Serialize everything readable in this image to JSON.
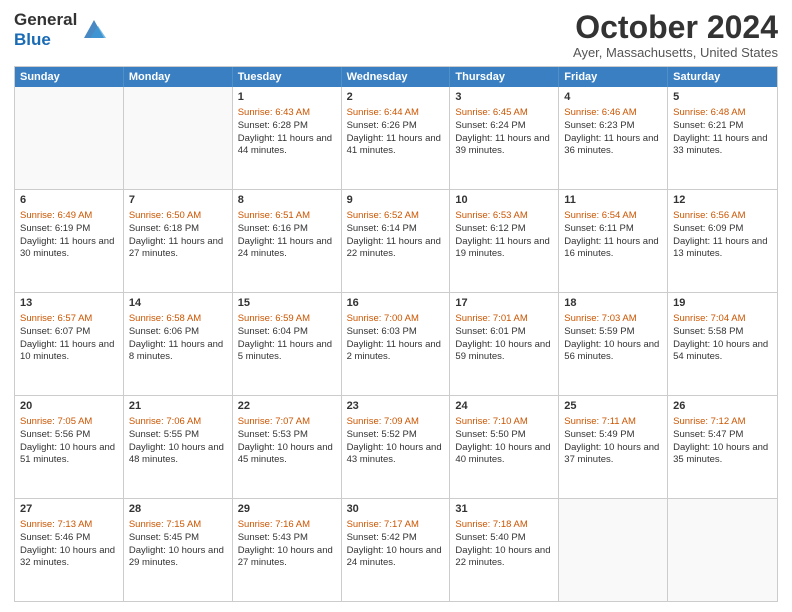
{
  "header": {
    "logo_line1": "General",
    "logo_line2": "Blue",
    "month": "October 2024",
    "location": "Ayer, Massachusetts, United States"
  },
  "weekdays": [
    "Sunday",
    "Monday",
    "Tuesday",
    "Wednesday",
    "Thursday",
    "Friday",
    "Saturday"
  ],
  "weeks": [
    [
      {
        "day": "",
        "sunrise": "",
        "sunset": "",
        "daylight": ""
      },
      {
        "day": "",
        "sunrise": "",
        "sunset": "",
        "daylight": ""
      },
      {
        "day": "1",
        "sunrise": "Sunrise: 6:43 AM",
        "sunset": "Sunset: 6:28 PM",
        "daylight": "Daylight: 11 hours and 44 minutes."
      },
      {
        "day": "2",
        "sunrise": "Sunrise: 6:44 AM",
        "sunset": "Sunset: 6:26 PM",
        "daylight": "Daylight: 11 hours and 41 minutes."
      },
      {
        "day": "3",
        "sunrise": "Sunrise: 6:45 AM",
        "sunset": "Sunset: 6:24 PM",
        "daylight": "Daylight: 11 hours and 39 minutes."
      },
      {
        "day": "4",
        "sunrise": "Sunrise: 6:46 AM",
        "sunset": "Sunset: 6:23 PM",
        "daylight": "Daylight: 11 hours and 36 minutes."
      },
      {
        "day": "5",
        "sunrise": "Sunrise: 6:48 AM",
        "sunset": "Sunset: 6:21 PM",
        "daylight": "Daylight: 11 hours and 33 minutes."
      }
    ],
    [
      {
        "day": "6",
        "sunrise": "Sunrise: 6:49 AM",
        "sunset": "Sunset: 6:19 PM",
        "daylight": "Daylight: 11 hours and 30 minutes."
      },
      {
        "day": "7",
        "sunrise": "Sunrise: 6:50 AM",
        "sunset": "Sunset: 6:18 PM",
        "daylight": "Daylight: 11 hours and 27 minutes."
      },
      {
        "day": "8",
        "sunrise": "Sunrise: 6:51 AM",
        "sunset": "Sunset: 6:16 PM",
        "daylight": "Daylight: 11 hours and 24 minutes."
      },
      {
        "day": "9",
        "sunrise": "Sunrise: 6:52 AM",
        "sunset": "Sunset: 6:14 PM",
        "daylight": "Daylight: 11 hours and 22 minutes."
      },
      {
        "day": "10",
        "sunrise": "Sunrise: 6:53 AM",
        "sunset": "Sunset: 6:12 PM",
        "daylight": "Daylight: 11 hours and 19 minutes."
      },
      {
        "day": "11",
        "sunrise": "Sunrise: 6:54 AM",
        "sunset": "Sunset: 6:11 PM",
        "daylight": "Daylight: 11 hours and 16 minutes."
      },
      {
        "day": "12",
        "sunrise": "Sunrise: 6:56 AM",
        "sunset": "Sunset: 6:09 PM",
        "daylight": "Daylight: 11 hours and 13 minutes."
      }
    ],
    [
      {
        "day": "13",
        "sunrise": "Sunrise: 6:57 AM",
        "sunset": "Sunset: 6:07 PM",
        "daylight": "Daylight: 11 hours and 10 minutes."
      },
      {
        "day": "14",
        "sunrise": "Sunrise: 6:58 AM",
        "sunset": "Sunset: 6:06 PM",
        "daylight": "Daylight: 11 hours and 8 minutes."
      },
      {
        "day": "15",
        "sunrise": "Sunrise: 6:59 AM",
        "sunset": "Sunset: 6:04 PM",
        "daylight": "Daylight: 11 hours and 5 minutes."
      },
      {
        "day": "16",
        "sunrise": "Sunrise: 7:00 AM",
        "sunset": "Sunset: 6:03 PM",
        "daylight": "Daylight: 11 hours and 2 minutes."
      },
      {
        "day": "17",
        "sunrise": "Sunrise: 7:01 AM",
        "sunset": "Sunset: 6:01 PM",
        "daylight": "Daylight: 10 hours and 59 minutes."
      },
      {
        "day": "18",
        "sunrise": "Sunrise: 7:03 AM",
        "sunset": "Sunset: 5:59 PM",
        "daylight": "Daylight: 10 hours and 56 minutes."
      },
      {
        "day": "19",
        "sunrise": "Sunrise: 7:04 AM",
        "sunset": "Sunset: 5:58 PM",
        "daylight": "Daylight: 10 hours and 54 minutes."
      }
    ],
    [
      {
        "day": "20",
        "sunrise": "Sunrise: 7:05 AM",
        "sunset": "Sunset: 5:56 PM",
        "daylight": "Daylight: 10 hours and 51 minutes."
      },
      {
        "day": "21",
        "sunrise": "Sunrise: 7:06 AM",
        "sunset": "Sunset: 5:55 PM",
        "daylight": "Daylight: 10 hours and 48 minutes."
      },
      {
        "day": "22",
        "sunrise": "Sunrise: 7:07 AM",
        "sunset": "Sunset: 5:53 PM",
        "daylight": "Daylight: 10 hours and 45 minutes."
      },
      {
        "day": "23",
        "sunrise": "Sunrise: 7:09 AM",
        "sunset": "Sunset: 5:52 PM",
        "daylight": "Daylight: 10 hours and 43 minutes."
      },
      {
        "day": "24",
        "sunrise": "Sunrise: 7:10 AM",
        "sunset": "Sunset: 5:50 PM",
        "daylight": "Daylight: 10 hours and 40 minutes."
      },
      {
        "day": "25",
        "sunrise": "Sunrise: 7:11 AM",
        "sunset": "Sunset: 5:49 PM",
        "daylight": "Daylight: 10 hours and 37 minutes."
      },
      {
        "day": "26",
        "sunrise": "Sunrise: 7:12 AM",
        "sunset": "Sunset: 5:47 PM",
        "daylight": "Daylight: 10 hours and 35 minutes."
      }
    ],
    [
      {
        "day": "27",
        "sunrise": "Sunrise: 7:13 AM",
        "sunset": "Sunset: 5:46 PM",
        "daylight": "Daylight: 10 hours and 32 minutes."
      },
      {
        "day": "28",
        "sunrise": "Sunrise: 7:15 AM",
        "sunset": "Sunset: 5:45 PM",
        "daylight": "Daylight: 10 hours and 29 minutes."
      },
      {
        "day": "29",
        "sunrise": "Sunrise: 7:16 AM",
        "sunset": "Sunset: 5:43 PM",
        "daylight": "Daylight: 10 hours and 27 minutes."
      },
      {
        "day": "30",
        "sunrise": "Sunrise: 7:17 AM",
        "sunset": "Sunset: 5:42 PM",
        "daylight": "Daylight: 10 hours and 24 minutes."
      },
      {
        "day": "31",
        "sunrise": "Sunrise: 7:18 AM",
        "sunset": "Sunset: 5:40 PM",
        "daylight": "Daylight: 10 hours and 22 minutes."
      },
      {
        "day": "",
        "sunrise": "",
        "sunset": "",
        "daylight": ""
      },
      {
        "day": "",
        "sunrise": "",
        "sunset": "",
        "daylight": ""
      }
    ]
  ]
}
